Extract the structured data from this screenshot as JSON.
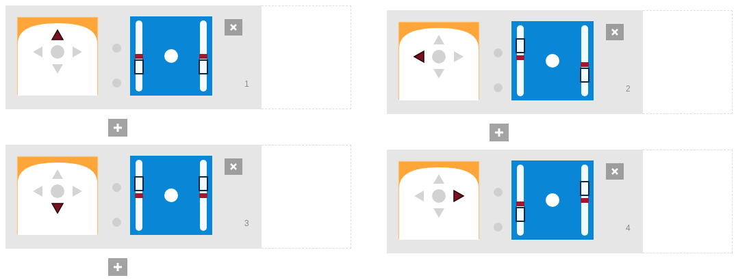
{
  "columns": [
    {
      "steps": [
        {
          "number": "1",
          "arrows": [
            {
              "kind": "up",
              "selected": true
            },
            {
              "kind": "left",
              "selected": false
            },
            {
              "kind": "right",
              "selected": false
            },
            {
              "kind": "down",
              "selected": false
            }
          ],
          "sliders": [
            {
              "marks": [
                {
                  "kind": "marker",
                  "level": 0.5
                },
                {
                  "kind": "handle",
                  "level": 0.35
                }
              ]
            },
            {
              "marks": [
                {
                  "kind": "marker",
                  "level": 0.5
                },
                {
                  "kind": "handle",
                  "level": 0.35
                }
              ]
            }
          ],
          "add_after": true
        },
        {
          "number": "3",
          "arrows": [
            {
              "kind": "up",
              "selected": false
            },
            {
              "kind": "left",
              "selected": false
            },
            {
              "kind": "right",
              "selected": false
            },
            {
              "kind": "down",
              "selected": true
            }
          ],
          "sliders": [
            {
              "marks": [
                {
                  "kind": "marker",
                  "level": 0.5
                },
                {
                  "kind": "handle",
                  "level": 0.66
                }
              ]
            },
            {
              "marks": [
                {
                  "kind": "marker",
                  "level": 0.5
                },
                {
                  "kind": "handle",
                  "level": 0.66
                }
              ]
            }
          ],
          "add_after": true
        }
      ]
    },
    {
      "steps": [
        {
          "number": "2",
          "arrows": [
            {
              "kind": "up",
              "selected": false
            },
            {
              "kind": "left",
              "selected": true
            },
            {
              "kind": "right",
              "selected": false
            },
            {
              "kind": "down",
              "selected": false
            }
          ],
          "sliders": [
            {
              "marks": [
                {
                  "kind": "marker",
                  "level": 0.55
                },
                {
                  "kind": "handle",
                  "level": 0.71
                }
              ]
            },
            {
              "marks": [
                {
                  "kind": "marker",
                  "level": 0.45
                },
                {
                  "kind": "handle",
                  "level": 0.3
                }
              ]
            }
          ],
          "add_after": true
        },
        {
          "number": "4",
          "arrows": [
            {
              "kind": "up",
              "selected": false
            },
            {
              "kind": "left",
              "selected": false
            },
            {
              "kind": "right",
              "selected": true
            },
            {
              "kind": "down",
              "selected": false
            }
          ],
          "sliders": [
            {
              "marks": [
                {
                  "kind": "marker",
                  "level": 0.45
                },
                {
                  "kind": "handle",
                  "level": 0.3
                }
              ]
            },
            {
              "marks": [
                {
                  "kind": "marker",
                  "level": 0.5
                },
                {
                  "kind": "handle",
                  "level": 0.66
                }
              ]
            }
          ],
          "add_after": false
        }
      ]
    }
  ]
}
